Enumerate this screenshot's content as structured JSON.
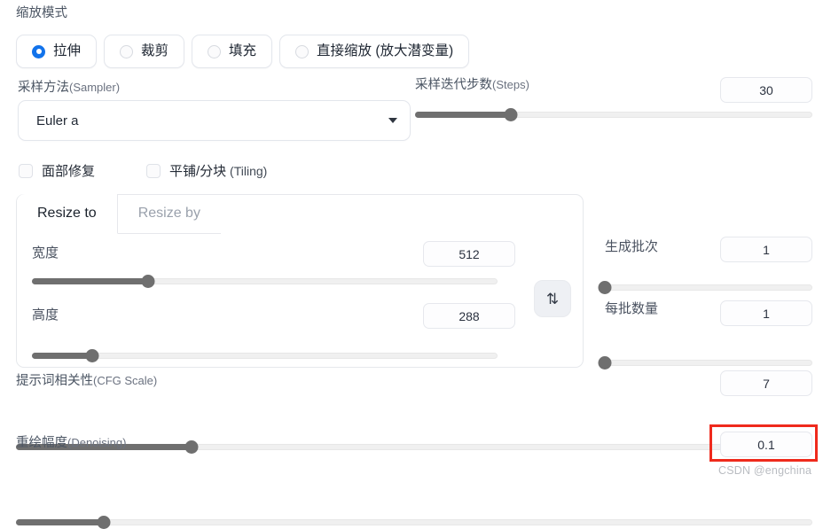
{
  "resize_mode": {
    "label": "缩放模式",
    "options": [
      {
        "label": "拉伸",
        "selected": true
      },
      {
        "label": "裁剪",
        "selected": false
      },
      {
        "label": "填充",
        "selected": false
      },
      {
        "label": "直接缩放 (放大潜变量)",
        "selected": false
      }
    ]
  },
  "sampler": {
    "label": "采样方法(Sampler)",
    "label_cn": "采样方法",
    "label_en": "(Sampler)",
    "value": "Euler a",
    "caret_icon": "chevron-down-icon"
  },
  "steps": {
    "label_cn": "采样迭代步数",
    "label_en": "(Steps)",
    "value": "30",
    "slider_percent": 24
  },
  "toggles": [
    {
      "label_cn": "面部修复",
      "label_en": "",
      "checked": false
    },
    {
      "label_cn": "平铺/分块",
      "label_en": " (Tiling)",
      "checked": false
    }
  ],
  "resize_tabs": {
    "tabs": [
      {
        "label": "Resize to",
        "active": true
      },
      {
        "label": "Resize by",
        "active": false
      }
    ],
    "width": {
      "label": "宽度",
      "value": "512",
      "slider_percent": 25
    },
    "height": {
      "label": "高度",
      "value": "288",
      "slider_percent": 13
    },
    "swap_icon": "swap-vertical-icon",
    "swap_glyph": "⇅"
  },
  "batch_count": {
    "label": "生成批次",
    "value": "1",
    "slider_percent": 0
  },
  "batch_size": {
    "label": "每批数量",
    "value": "1",
    "slider_percent": 0
  },
  "cfg_scale": {
    "label_cn": "提示词相关性",
    "label_en": "(CFG Scale)",
    "value": "7",
    "slider_percent": 22
  },
  "denoising": {
    "label_cn": "重绘幅度",
    "label_en": "(Denoising)",
    "value": "0.1",
    "slider_percent": 11,
    "highlighted": true,
    "highlight_color": "#ef2a1c"
  },
  "watermark": {
    "text": "CSDN @engchina"
  }
}
